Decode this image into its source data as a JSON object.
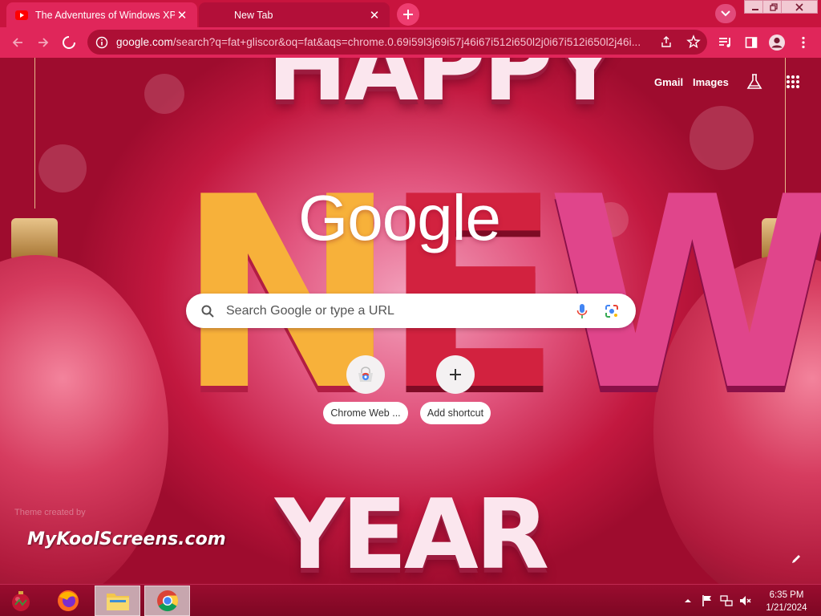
{
  "tabs": [
    {
      "title": "The Adventures of Windows XP [",
      "favicon": "youtube-icon",
      "active": false
    },
    {
      "title": "New Tab",
      "favicon": "none",
      "active": true
    }
  ],
  "omnibox": {
    "url_host": "google.com",
    "url_path": "/search?q=fat+gliscor&oq=fat&aqs=chrome.0.69i59l3j69i57j46i67i512i650l2j0i67i512i650l2j46i..."
  },
  "google": {
    "links": {
      "gmail": "Gmail",
      "images": "Images"
    },
    "logo": "Google",
    "search_placeholder": "Search Google or type a URL",
    "shortcuts": [
      {
        "label": "Chrome Web ...",
        "icon": "chrome-web-store-icon"
      },
      {
        "label": "Add shortcut",
        "icon": "plus-icon"
      }
    ]
  },
  "theme": {
    "credit": "Theme created by",
    "brand": "MyKoolScreens.com",
    "background_text_top": "HAPPY",
    "background_text_mid": "NEW",
    "background_text_bottom": "YEAR"
  },
  "taskbar": {
    "time": "6:35 PM",
    "date": "1/21/2024"
  },
  "colors": {
    "tabstrip": "#c8143e",
    "toolbar": "#e0265a",
    "omnibox": "#ad0f35",
    "taskbar": "#8a0a29"
  }
}
